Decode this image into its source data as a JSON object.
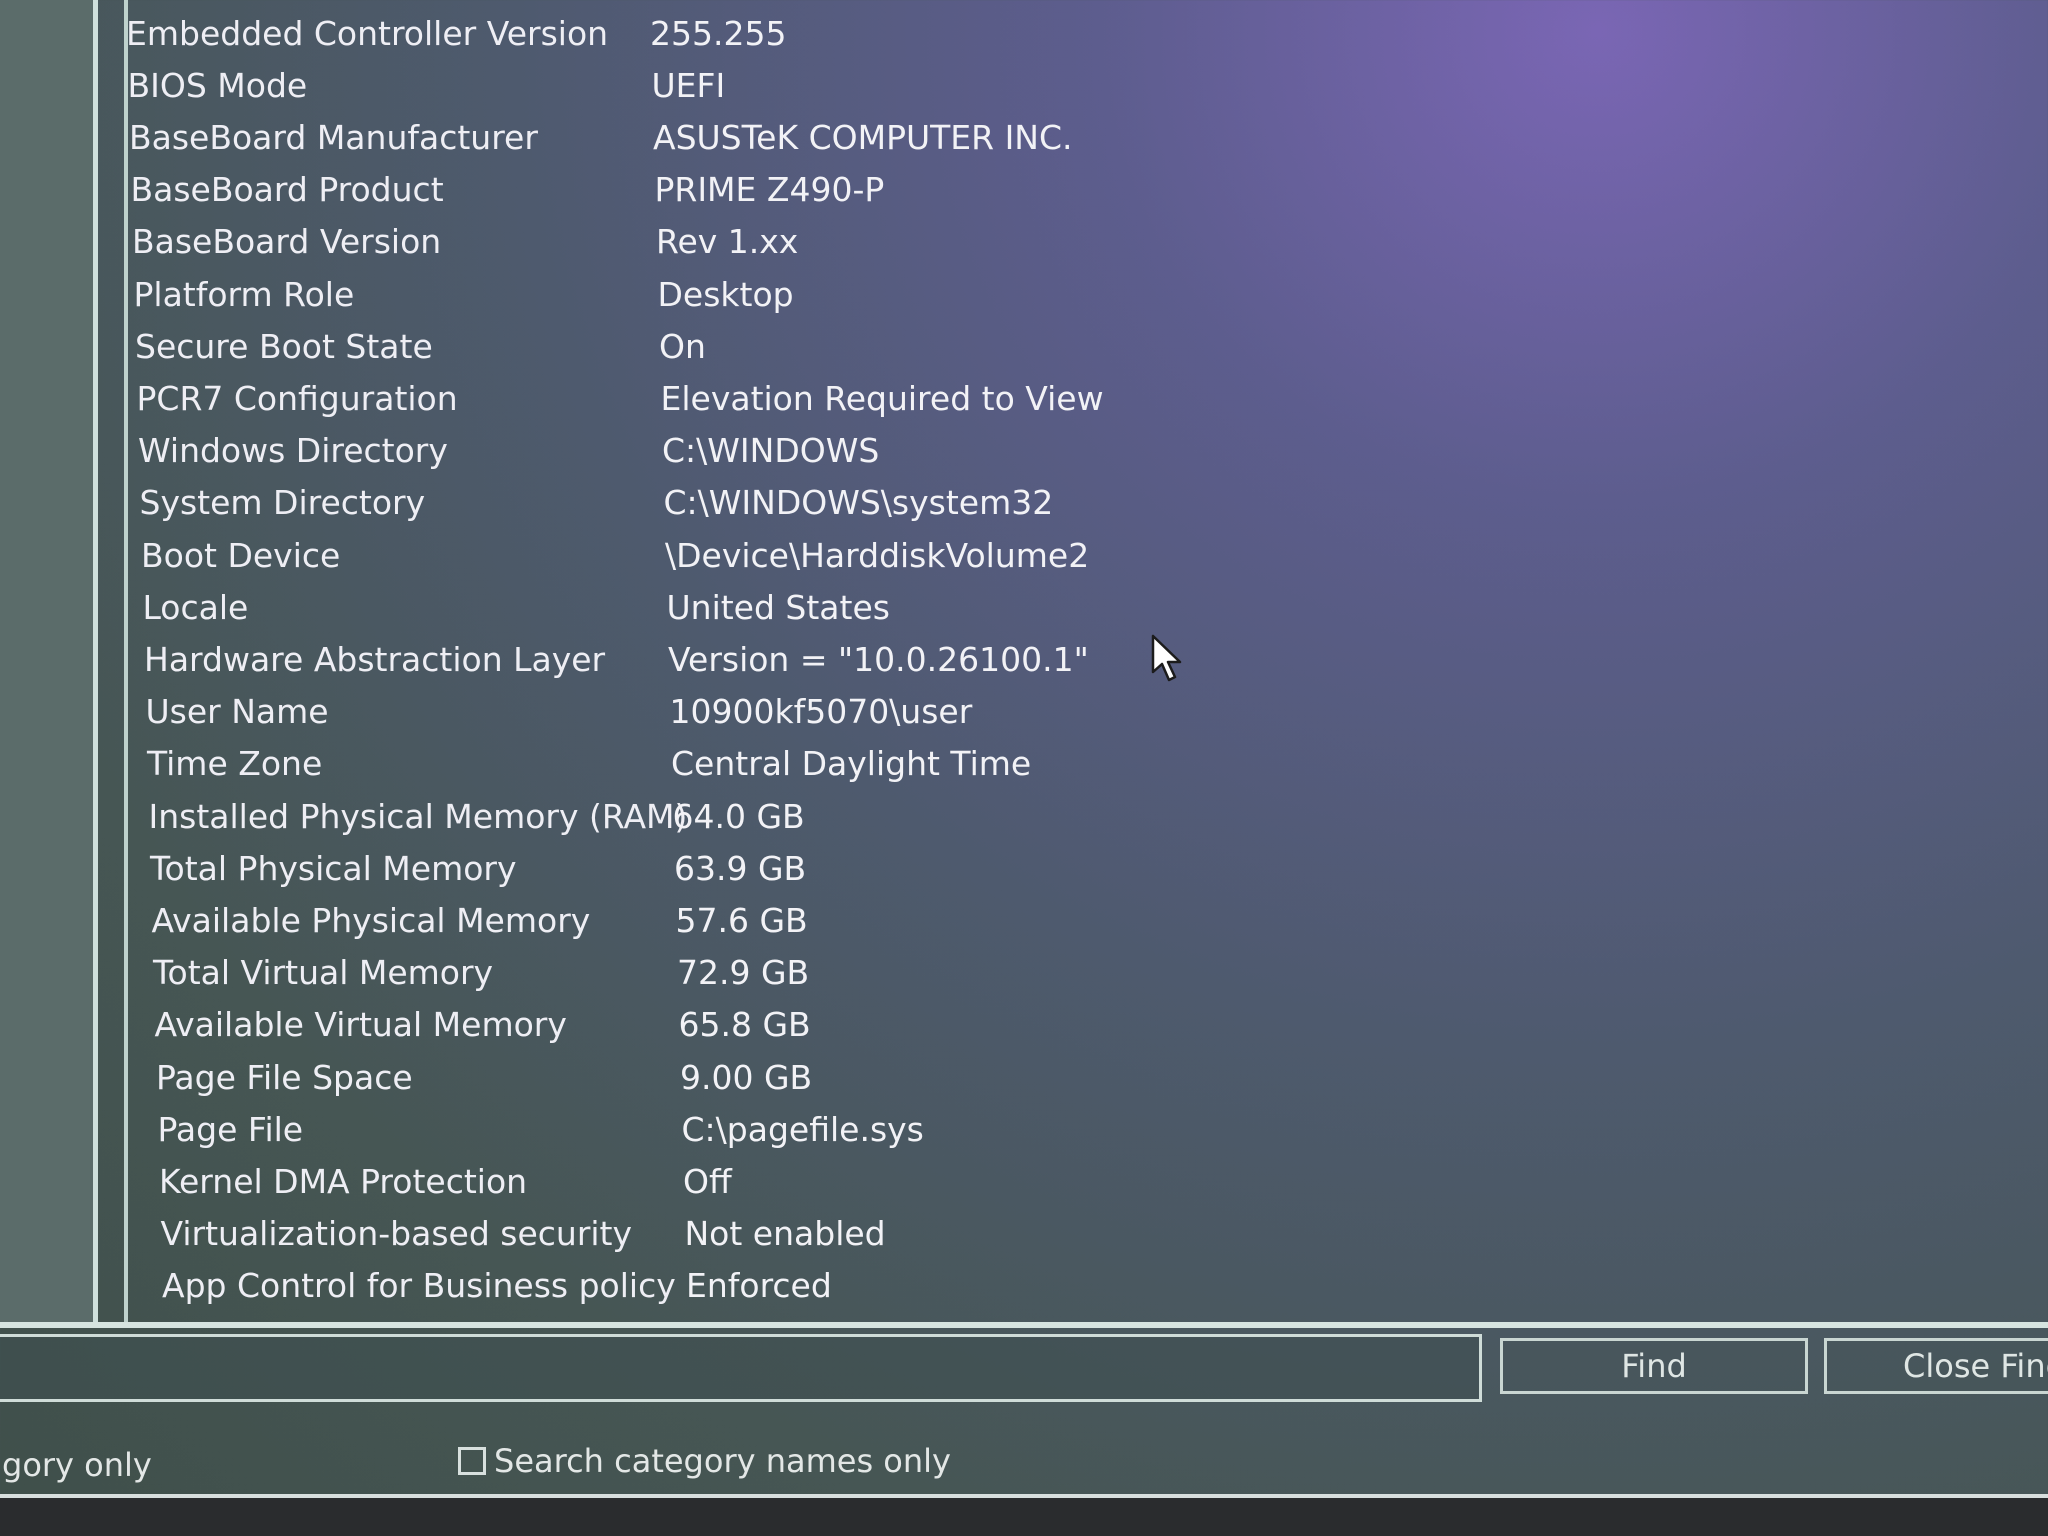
{
  "system_summary": {
    "rows": [
      {
        "item": "Embedded Controller Version",
        "value": "255.255"
      },
      {
        "item": "BIOS Mode",
        "value": "UEFI"
      },
      {
        "item": "BaseBoard Manufacturer",
        "value": "ASUSTeK COMPUTER INC."
      },
      {
        "item": "BaseBoard Product",
        "value": "PRIME Z490-P"
      },
      {
        "item": "BaseBoard Version",
        "value": "Rev 1.xx"
      },
      {
        "item": "Platform Role",
        "value": "Desktop"
      },
      {
        "item": "Secure Boot State",
        "value": "On"
      },
      {
        "item": "PCR7 Configuration",
        "value": "Elevation Required to View"
      },
      {
        "item": "Windows Directory",
        "value": "C:\\WINDOWS"
      },
      {
        "item": "System Directory",
        "value": "C:\\WINDOWS\\system32"
      },
      {
        "item": "Boot Device",
        "value": "\\Device\\HarddiskVolume2"
      },
      {
        "item": "Locale",
        "value": "United States"
      },
      {
        "item": "Hardware Abstraction Layer",
        "value": "Version = \"10.0.26100.1\""
      },
      {
        "item": "User Name",
        "value": "10900kf5070\\user"
      },
      {
        "item": "Time Zone",
        "value": "Central Daylight Time"
      },
      {
        "item": "Installed Physical Memory (RAM)",
        "value": "64.0 GB"
      },
      {
        "item": "Total Physical Memory",
        "value": "63.9 GB"
      },
      {
        "item": "Available Physical Memory",
        "value": "57.6 GB"
      },
      {
        "item": "Total Virtual Memory",
        "value": "72.9 GB"
      },
      {
        "item": "Available Virtual Memory",
        "value": "65.8 GB"
      },
      {
        "item": "Page File Space",
        "value": "9.00 GB"
      },
      {
        "item": "Page File",
        "value": "C:\\pagefile.sys"
      },
      {
        "item": "Kernel DMA Protection",
        "value": "Off"
      },
      {
        "item": "Virtualization-based security",
        "value": "Not enabled"
      },
      {
        "item": "App Control for Business policy",
        "value": "Enforced"
      }
    ]
  },
  "find_bar": {
    "find_input_value": "",
    "find_button_label": "Find",
    "close_find_button_label": "Close Finc",
    "selected_category_option": "gory only",
    "search_category_names_label": "Search category names only",
    "search_category_names_checked": false
  },
  "icons": {
    "cursor": "mouse-pointer-icon"
  }
}
